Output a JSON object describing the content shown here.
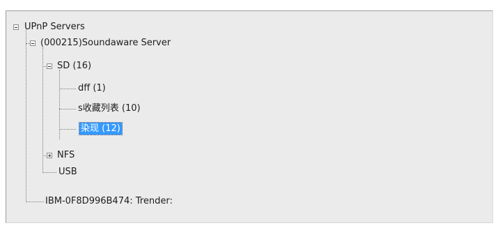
{
  "tree": {
    "root": {
      "label": "UPnP Servers",
      "expanded": true
    },
    "server": {
      "label": "(000215)Soundaware Server",
      "expanded": true
    },
    "sd": {
      "label": "SD (16)",
      "expanded": true
    },
    "dff": {
      "label": "dff (1)"
    },
    "fav": {
      "label": "s收藏列表 (10)"
    },
    "ranxian": {
      "label": "染现 (12)",
      "selected": true
    },
    "nfs": {
      "label": "NFS",
      "expanded": false
    },
    "usb": {
      "label": "USB"
    },
    "renderer": {
      "label": "IBM-0F8D996B474: Trender:"
    }
  },
  "colors": {
    "selection": "#3399ff",
    "panel_bg": "#ebebeb"
  }
}
